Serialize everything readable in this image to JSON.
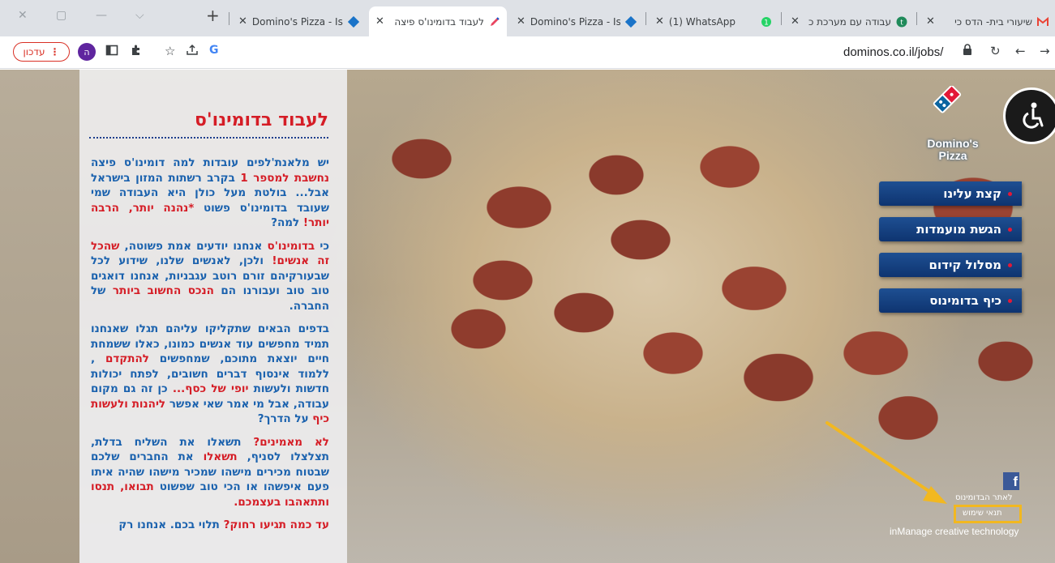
{
  "browser": {
    "tabs": [
      {
        "title": "שיעורי בית- הדס כי",
        "favicon": "gmail-icon"
      },
      {
        "title": "עבודה עם מערכת כ",
        "favicon": "t-icon"
      },
      {
        "title": "(1) WhatsApp",
        "favicon": "whatsapp-icon"
      },
      {
        "title": "Domino's Pizza - Isr",
        "favicon": "dominos-icon"
      },
      {
        "title": "לעבוד בדומינו'ס פיצה",
        "favicon": "pencil-icon"
      },
      {
        "title": "Domino's Pizza - Isr",
        "favicon": "dominos-icon"
      }
    ],
    "update_label": "עדכון",
    "profile_initial": "ה",
    "url": "dominos.co.il/jobs/"
  },
  "page": {
    "title": "לעבוד בדומינו'ס",
    "p1": {
      "a": "יש מלאנת'לפים עובדות למה דומינו'ס פיצה ",
      "b": "נחשבת למספר 1",
      "c": " בקרב רשתות המזון בישראל אבל... בולטת מעל כולן היא העבודה שמי שעובד בדומינו'ס פשוט ",
      "d": "*נהנה יותר, הרבה יותר!",
      "e": " למה?"
    },
    "p2": {
      "a": "כי ",
      "b": "בדומינו'ס",
      "c": " אנחנו יודעים אמת פשוטה, ",
      "d": "שהכל זה אנשים!",
      "e": " ולכן, לאנשים שלנו, שידוע לכל שבעורקיהם זורם רוטב עגבניות, אנחנו דואגים טוב טוב ועבורנו הם ",
      "f": "הנכס החשוב ביותר",
      "g": " של החברה."
    },
    "p3": {
      "a": "בדפים הבאים שתקליקו עליהם תגלו שאנחנו תמיד מחפשים עוד אנשים כמונו, כאלו ששמחת חיים יוצאת מתוכם, שמחפשים ",
      "b": "להתקדם",
      "c": " , ללמוד אינסוף דברים חשובים, לפתח יכולות חדשות ולעשות ",
      "d": "יופי של כסף...",
      "e": " כן זה גם מקום עבודה, אבל מי אמר שאי אפשר ",
      "f": "ליהנות ולעשות כיף",
      "g": " על הדרך?"
    },
    "p4": {
      "a": "לא מאמינים?",
      "b": " תשאלו את השליח בדלת, תצלצלו לסניף, ",
      "c": "תשאלו",
      "d": " את החברים שלכם שבטוח מכירים מישהו שמכיר מישהו שהיה איתו פעם איפשהו או הכי טוב שפשוט ",
      "e": "תבואו, תנסו ותתאהבו בעצמכם."
    },
    "p5": {
      "a": "עד כמה תגיעו רחוק?",
      "b": " תלוי בכם. אנחנו רק"
    },
    "logo": {
      "line1": "Domino's",
      "line2": "Pizza"
    },
    "nav": [
      {
        "label": "קצת עלינו"
      },
      {
        "label": "הגשת מועמדות"
      },
      {
        "label": "מסלול קידום"
      },
      {
        "label": "כיף בדומינוס"
      }
    ],
    "footer": {
      "link1": "לאתר הבדומינוס",
      "link2": "תנאי שימוש",
      "credit": "inManage creative technology"
    }
  },
  "colors": {
    "brand_red": "#d51d26",
    "brand_blue": "#1b62ae",
    "nav_blue": "#0e3470",
    "highlight": "#f2b820"
  }
}
